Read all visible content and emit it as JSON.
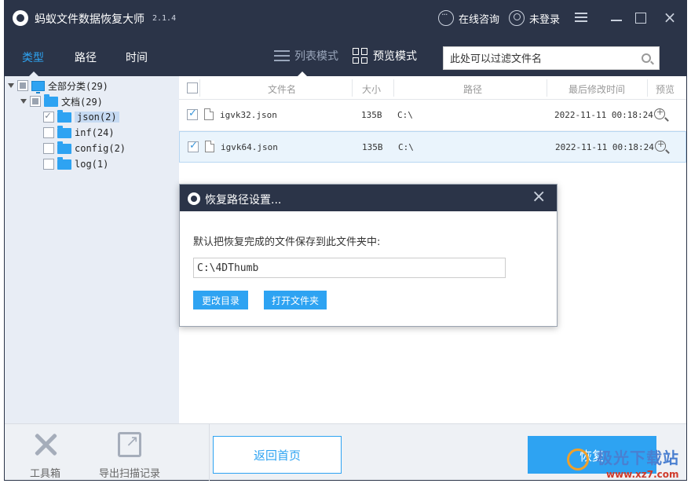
{
  "app": {
    "title": "蚂蚁文件数据恢复大师",
    "version": "2.1.4",
    "online_consult": "在线咨询",
    "login": "未登录"
  },
  "nav": {
    "tabs": [
      {
        "label": "类型",
        "active": true
      },
      {
        "label": "路径",
        "active": false
      },
      {
        "label": "时间",
        "active": false
      }
    ],
    "list_mode": "列表模式",
    "preview_mode": "预览模式",
    "filter_placeholder": "此处可以过滤文件名"
  },
  "tree": {
    "root": "全部分类(29)",
    "docs": "文档(29)",
    "items": [
      {
        "label": "json(2)",
        "checked": true,
        "selected": true
      },
      {
        "label": "inf(24)",
        "checked": false,
        "selected": false
      },
      {
        "label": "config(2)",
        "checked": false,
        "selected": false
      },
      {
        "label": "log(1)",
        "checked": false,
        "selected": false
      }
    ]
  },
  "table": {
    "headers": {
      "name": "文件名",
      "size": "大小",
      "path": "路径",
      "modified": "最后修改时间",
      "preview": "预览"
    },
    "rows": [
      {
        "name": "igvk32.json",
        "size": "135B",
        "path": "C:\\",
        "modified": "2022-11-11 00:18:24",
        "checked": true
      },
      {
        "name": "igvk64.json",
        "size": "135B",
        "path": "C:\\",
        "modified": "2022-11-11 00:18:24",
        "checked": true
      }
    ]
  },
  "dialog": {
    "title": "恢复路径设置...",
    "message": "默认把恢复完成的文件保存到此文件夹中:",
    "path_value": "C:\\4DThumb",
    "change_dir": "更改目录",
    "open_folder": "打开文件夹"
  },
  "bottom": {
    "toolbox": "工具箱",
    "export_scan": "导出扫描记录",
    "home": "返回首页",
    "recover": "恢复"
  },
  "watermark": {
    "brand": "极光下载站",
    "url": "www.xz7.com"
  },
  "colors": {
    "header_bg": "#2b3448",
    "accent": "#2ea3f2",
    "sidebar_bg": "#e8edf5"
  }
}
